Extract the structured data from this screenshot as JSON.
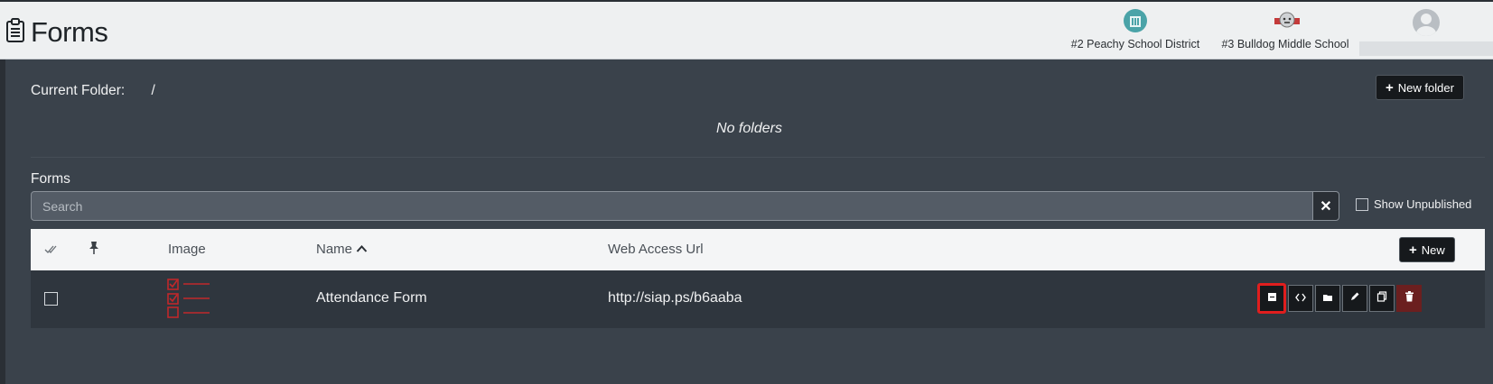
{
  "header": {
    "title": "Forms",
    "schools": [
      {
        "label": "#2 Peachy School District",
        "logo": "district-logo-icon",
        "color": "#4aa3a8"
      },
      {
        "label": "#3 Bulldog Middle School",
        "logo": "bulldog-logo-icon",
        "color": "#c43a3a"
      }
    ],
    "user_icon": "user-avatar-icon"
  },
  "folder": {
    "current_label": "Current Folder:",
    "current_path": "/",
    "new_folder_label": "New folder",
    "empty_text": "No folders"
  },
  "forms": {
    "section_label": "Forms",
    "search_placeholder": "Search",
    "show_unpublished_label": "Show Unpublished",
    "columns": {
      "image": "Image",
      "name": "Name",
      "url": "Web Access Url"
    },
    "new_label": "New",
    "rows": [
      {
        "name": "Attendance Form",
        "url": "http://siap.ps/b6aaba"
      }
    ],
    "action_icons": [
      "form-icon",
      "code-icon",
      "folder-icon",
      "edit-icon",
      "copy-icon",
      "trash-icon"
    ]
  },
  "colors": {
    "accent_red": "#e01e1e",
    "delete_bg": "#6b1f1f",
    "header_bg": "#eef0f1",
    "page_bg": "#3a424b"
  }
}
